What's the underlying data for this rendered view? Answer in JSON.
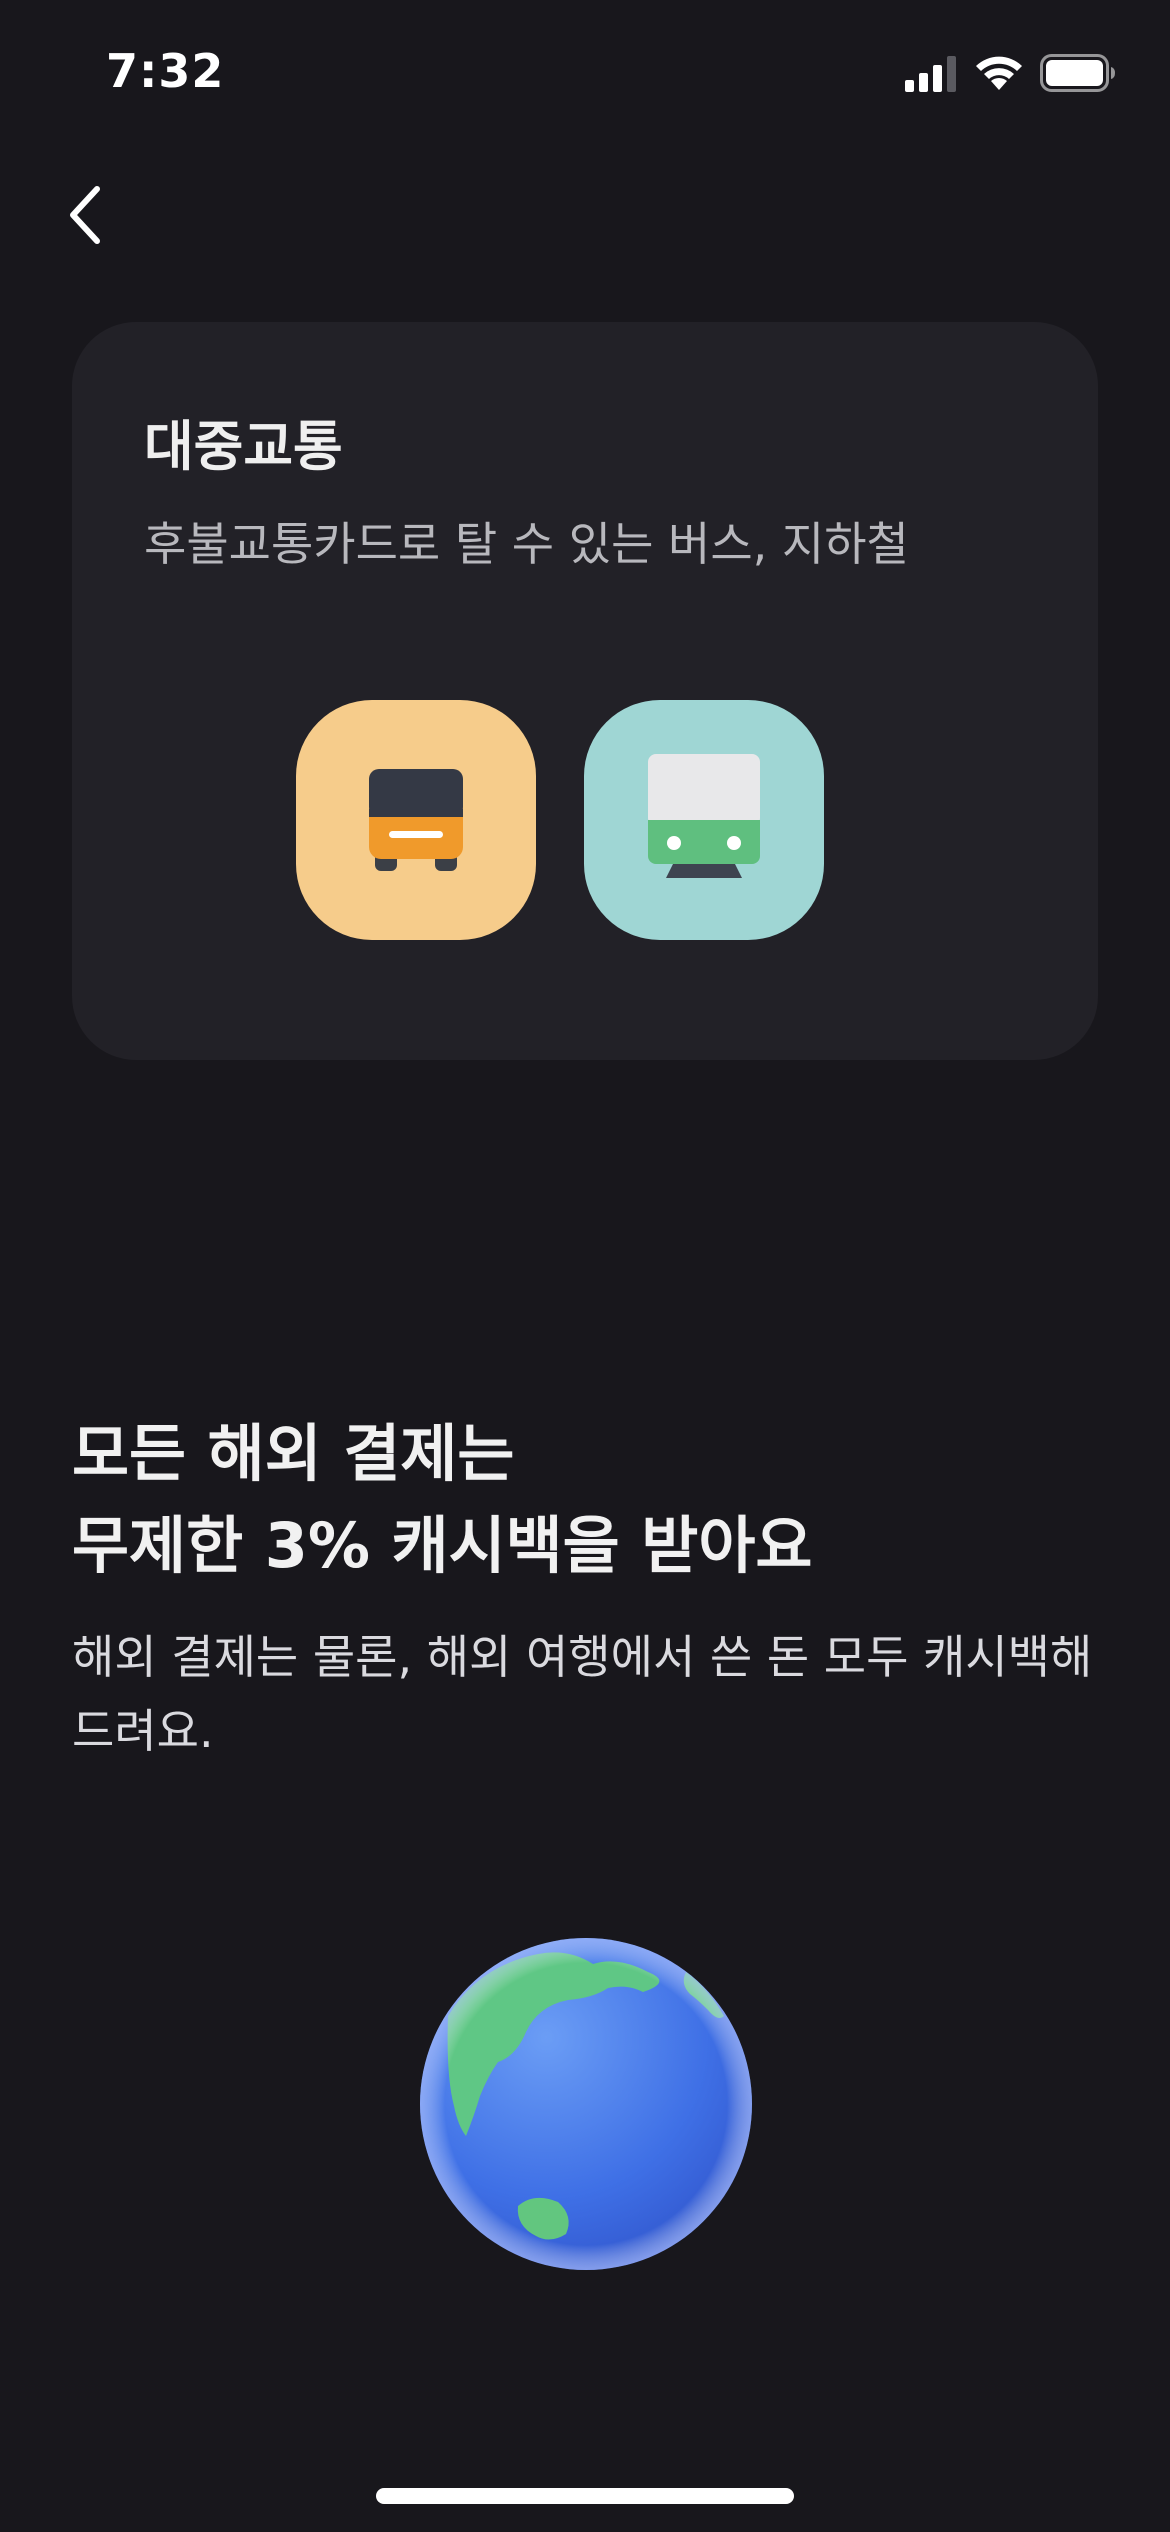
{
  "status_bar": {
    "time": "7:32",
    "icons": [
      "signal-icon",
      "wifi-icon",
      "battery-icon"
    ]
  },
  "nav": {
    "back_icon": "chevron-left-icon"
  },
  "transit_card": {
    "title": "대중교통",
    "description": "후불교통카드로 탈 수 있는 버스, 지하철",
    "icons": [
      "bus-icon",
      "subway-icon"
    ],
    "colors": {
      "bus_tile": "#f6cc8b",
      "subway_tile": "#9fd6d4",
      "card_bg": "#222127"
    }
  },
  "cashback": {
    "heading_line1": "모든 해외 결제는",
    "heading_line2": "무제한 3% 캐시백을 받아요",
    "description": "해외 결제는 물론, 해외 여행에서 쓴 돈 모두 캐시백해 드려요.",
    "image": "globe-icon"
  },
  "theme": {
    "background": "#18171c",
    "text_primary": "#f1f1f1",
    "text_secondary": "#b8b8bd"
  }
}
